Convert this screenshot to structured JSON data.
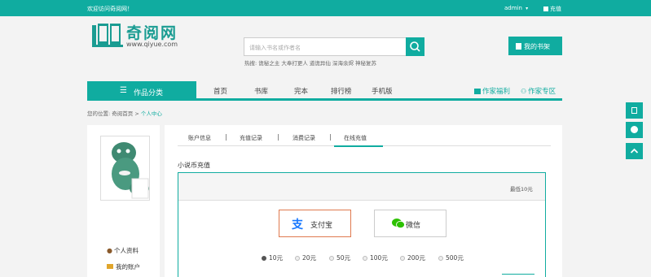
{
  "topbar": {
    "welcome": "欢迎访问奇阅网！",
    "user": "admin",
    "charge": "充值"
  },
  "logo": {
    "name": "奇阅网",
    "url": "www.qiyue.com"
  },
  "search": {
    "placeholder": "请输入书名或作者名",
    "hot": "热搜: 诡秘之主  大奉打更人  道诡异仙  深海余烬  神秘复苏"
  },
  "shelf_button": "我的书架",
  "nav": {
    "category": "作品分类",
    "items": [
      "首页",
      "书库",
      "完本",
      "排行榜",
      "手机版"
    ],
    "author_welfare": "作家福利",
    "author_zone": "作家专区"
  },
  "breadcrumb": {
    "prefix": "您的位置:",
    "home": "奇阅首页",
    "sep": ">",
    "current": "个人中心"
  },
  "sidebar": {
    "items": [
      "个人资料",
      "我的账户"
    ]
  },
  "tabs": [
    "账户信息",
    "充值记录",
    "消费记录",
    "在线充值"
  ],
  "section_title": "小说币充值",
  "min_note": "最低10元",
  "pay_options": {
    "alipay": "支付宝",
    "wechat": "微信"
  },
  "amounts": [
    "10元",
    "20元",
    "50元",
    "100元",
    "200元",
    "500元"
  ],
  "colors": {
    "accent": "#10aca0",
    "alipay_border": "#e07a4f"
  }
}
